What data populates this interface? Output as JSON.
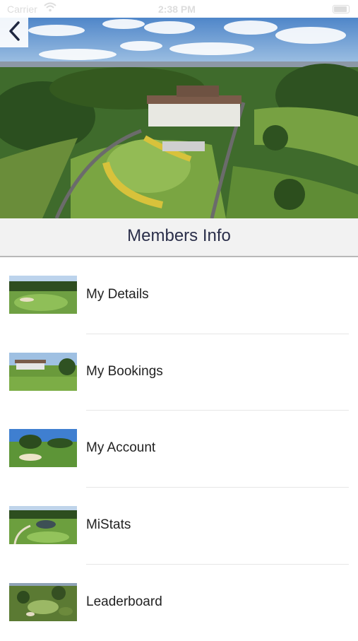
{
  "status_bar": {
    "carrier": "Carrier",
    "time": "2:38 PM"
  },
  "header": {
    "title": "Members Info"
  },
  "menu": {
    "items": [
      {
        "label": "My Details"
      },
      {
        "label": "My Bookings"
      },
      {
        "label": "My Account"
      },
      {
        "label": "MiStats"
      },
      {
        "label": "Leaderboard"
      }
    ]
  },
  "colors": {
    "title_text": "#2b2f4a",
    "header_bg": "#f2f2f2",
    "back_icon": "#1f2740",
    "fairway_green": "#5f9a3c"
  },
  "icons": {
    "back": "chevron-left-icon"
  }
}
